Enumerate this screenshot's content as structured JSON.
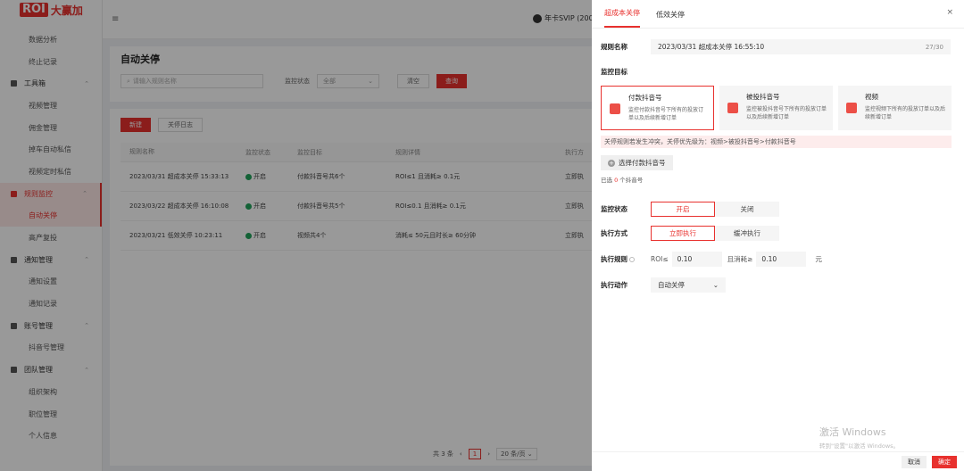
{
  "brand": {
    "logo_mark": "ROI",
    "logo_text": "大赢加"
  },
  "sidebar": {
    "items": [
      {
        "label": "数据分析",
        "type": "item"
      },
      {
        "label": "终止记录",
        "type": "item"
      },
      {
        "label": "工具箱",
        "type": "group"
      },
      {
        "label": "视频管理",
        "type": "item"
      },
      {
        "label": "佣金管理",
        "type": "item"
      },
      {
        "label": "掉车自动私信",
        "type": "item"
      },
      {
        "label": "视频定时私信",
        "type": "item"
      },
      {
        "label": "规则监控",
        "type": "group",
        "active": true
      },
      {
        "label": "自动关停",
        "type": "item",
        "active": true
      },
      {
        "label": "高产复投",
        "type": "item"
      },
      {
        "label": "通知管理",
        "type": "group"
      },
      {
        "label": "通知设置",
        "type": "item"
      },
      {
        "label": "通知记录",
        "type": "item"
      },
      {
        "label": "账号管理",
        "type": "group"
      },
      {
        "label": "抖音号管理",
        "type": "item"
      },
      {
        "label": "团队管理",
        "type": "group"
      },
      {
        "label": "组织架构",
        "type": "item"
      },
      {
        "label": "职位管理",
        "type": "item"
      },
      {
        "label": "个人信息",
        "type": "item"
      }
    ]
  },
  "topbar": {
    "vip_text": "年卡SVIP (200"
  },
  "page": {
    "title": "自动关停",
    "search_placeholder": "请输入规则名称",
    "status_label": "监控状态",
    "status_value": "全部",
    "clear_label": "清空",
    "query_label": "查询",
    "new_label": "新建",
    "log_label": "关停日志"
  },
  "table": {
    "headers": [
      "规则名称",
      "监控状态",
      "监控目标",
      "规则详情",
      "执行方"
    ],
    "rows": [
      {
        "name": "2023/03/31 超成本关停 15:33:13",
        "status": "开启",
        "target": "付款抖音号共6个",
        "detail": "ROI≤1 且消耗≥ 0.1元",
        "exec": "立即执"
      },
      {
        "name": "2023/03/22 超成本关停 16:10:08",
        "status": "开启",
        "target": "付款抖音号共5个",
        "detail": "ROI≤0.1 且消耗≥ 0.1元",
        "exec": "立即执"
      },
      {
        "name": "2023/03/21 低效关停 10:23:11",
        "status": "开启",
        "target": "视频共4个",
        "detail": "消耗≤ 50元且时长≥ 60分钟",
        "exec": "立即执"
      }
    ]
  },
  "pager": {
    "total": "共 3 条",
    "current": "1",
    "size": "20 条/页"
  },
  "drawer": {
    "tabs": [
      "超成本关停",
      "低效关停"
    ],
    "rule_name_label": "规则名称",
    "rule_name_value": "2023/03/31  超成本关停  16:55:10",
    "rule_name_count": "27/30",
    "target_section": "监控目标",
    "targets": [
      {
        "title": "付款抖音号",
        "desc": "监控付款抖音号下所有的投放订单以及后续新增订单"
      },
      {
        "title": "被投抖音号",
        "desc": "监控被投抖音号下所有的投放订单以及后续新增订单"
      },
      {
        "title": "视频",
        "desc": "监控视频下所有的投放订单以及后续新增订单"
      }
    ],
    "warning": "关停规则若发生冲突，关停优先级为：视频>被投抖音号>付款抖音号",
    "pick_label": "选择付款抖音号",
    "selected_prefix": "已选",
    "selected_num": "0",
    "selected_suffix": "个抖音号",
    "status_label": "监控状态",
    "status_on": "开启",
    "status_off": "关闭",
    "exec_label": "执行方式",
    "exec_now": "立即执行",
    "exec_buffer": "缓冲执行",
    "rule_label": "执行规则",
    "roi_label": "ROI≤",
    "roi_value": "0.10",
    "spend_label": "且消耗≥",
    "spend_value": "0.10",
    "unit": "元",
    "action_label": "执行动作",
    "action_value": "自动关停",
    "cancel_label": "取消",
    "ok_label": "确定"
  },
  "watermark": {
    "line1": "激活 Windows",
    "line2": "转到\"设置\"以激活 Windows。"
  },
  "colors": {
    "accent": "#e8312e",
    "success": "#21a35a"
  }
}
